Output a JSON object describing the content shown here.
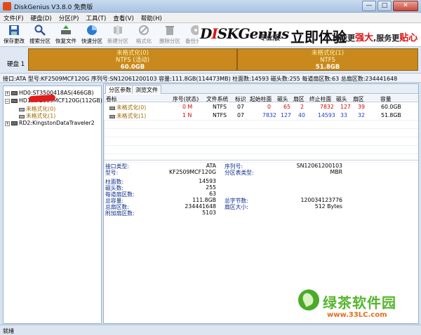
{
  "window": {
    "title": "DiskGenius V3.8.0 免费版",
    "min": "—",
    "max": "□",
    "close": "✕"
  },
  "menu": [
    "文件(F)",
    "硬盘(D)",
    "分区(P)",
    "工具(T)",
    "查看(V)",
    "帮助(H)"
  ],
  "toolbar": [
    {
      "label": "保存更改",
      "icon": "save-icon",
      "enabled": true
    },
    {
      "label": "搜索分区",
      "icon": "search-icon",
      "enabled": true
    },
    {
      "label": "恢复文件",
      "icon": "recover-icon",
      "enabled": true
    },
    {
      "label": "快速分区",
      "icon": "quick-partition-icon",
      "enabled": true
    },
    {
      "label": "新建分区",
      "icon": "new-partition-icon",
      "enabled": false
    },
    {
      "label": "格式化",
      "icon": "format-icon",
      "enabled": false
    },
    {
      "label": "删除分区",
      "icon": "delete-icon",
      "enabled": false
    },
    {
      "label": "备份分区",
      "icon": "backup-icon",
      "enabled": false
    }
  ],
  "banner": {
    "brand_a": "D",
    "brand_b": "I",
    "brand_c": "SKGenius",
    "edition": "专业版",
    "calligraphy": "立即体验",
    "slogan_a": "功能更",
    "slogan_b": "强大",
    "slogan_c": ",服务更",
    "slogan_d": "贴心"
  },
  "diskmap": {
    "disk_label": "硬盘 1",
    "partitions": [
      {
        "line1": "未格式化(0)",
        "line2": "NTFS (活动)",
        "line3": "60.0GB"
      },
      {
        "line1": "未格式化(1)",
        "line2": "NTFS",
        "line3": "51.8GB"
      }
    ]
  },
  "infobar": "接口:ATA  型号:KF2509MCF120G  序列号:SN12061200103  容量:111.8GB(114473MB)  柱面数:14593  磁头数:255  每道扇区数:63  总扇区数:234441648",
  "tree": [
    {
      "label": "HD0:ST3500418AS(466GB)",
      "kind": "disk",
      "exp": "+"
    },
    {
      "label": "HD1:KF2509MCF120G(112GB)",
      "kind": "disk",
      "exp": "−"
    },
    {
      "label": "未格式化(0)",
      "kind": "part"
    },
    {
      "label": "未格式化(1)",
      "kind": "part"
    },
    {
      "label": "RD2:KingstonDataTraveler2",
      "kind": "disk",
      "exp": "+"
    }
  ],
  "tabs": [
    "分区参数",
    "浏览文件"
  ],
  "table": {
    "headers": [
      "卷标",
      "序号(状态)",
      "文件系统",
      "标识",
      "起始柱面",
      "磁头",
      "扇区",
      "终止柱面",
      "磁头",
      "扇区",
      "容量"
    ],
    "rows": [
      [
        "未格式化(0)",
        "0 M",
        "NTFS",
        "07",
        "0",
        "65",
        "2",
        "7832",
        "127",
        "39",
        "60.0GB"
      ],
      [
        "未格式化(1)",
        "1 N",
        "NTFS",
        "07",
        "7832",
        "127",
        "40",
        "14593",
        "33",
        "32",
        "51.8GB"
      ]
    ]
  },
  "details": {
    "iface_label": "接口类型:",
    "iface": "ATA",
    "serial_label": "序列号:",
    "serial": "SN12061200103",
    "model_label": "型号:",
    "model": "KF2509MCF120G",
    "ptype_label": "分区表类型:",
    "ptype": "MBR",
    "cyl_label": "柱面数:",
    "cyl": "14593",
    "heads_label": "磁头数:",
    "heads": "255",
    "spt_label": "每道扇区数:",
    "spt": "63",
    "cap_label": "总容量:",
    "cap": "111.8GB",
    "bytes_label": "总字节数:",
    "bytes": "120034123776",
    "sectors_label": "总扇区数:",
    "sectors": "234441648",
    "ssize_label": "扇区大小:",
    "ssize": "512 Bytes",
    "extra_label": "附加扇区数:",
    "extra": "5103"
  },
  "status": "就绪",
  "watermark": {
    "text": "绿茶软件园",
    "url": "www.33LC.com"
  }
}
